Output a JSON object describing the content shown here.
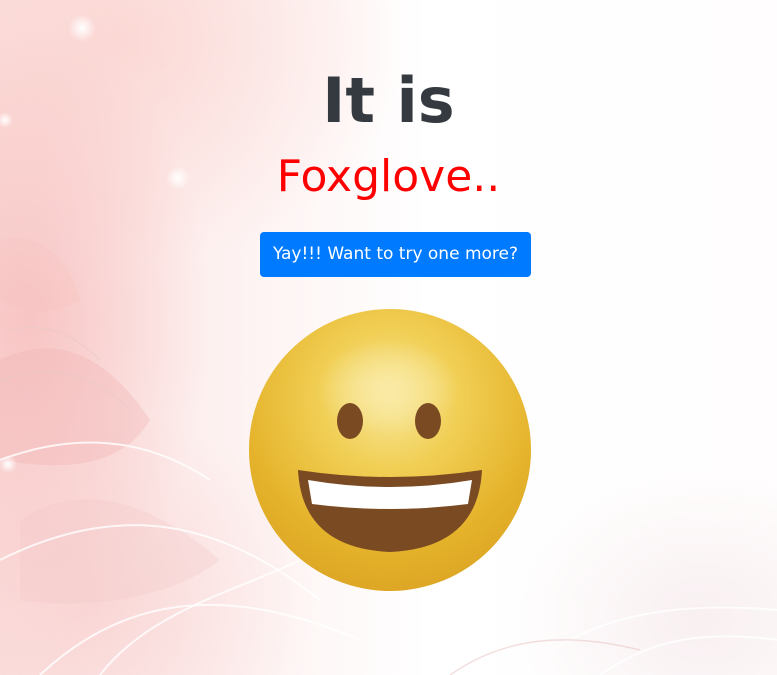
{
  "page": {
    "heading": "It is",
    "answer": "Foxglove..",
    "retry_button_label": "Yay!!! Want to try one more?"
  },
  "illustration": {
    "icon": "grinning-face-icon"
  },
  "colors": {
    "heading": "#343a40",
    "answer": "#ff0000",
    "button": "#007bff",
    "face": "#e8b426",
    "features": "#7a4a22"
  }
}
